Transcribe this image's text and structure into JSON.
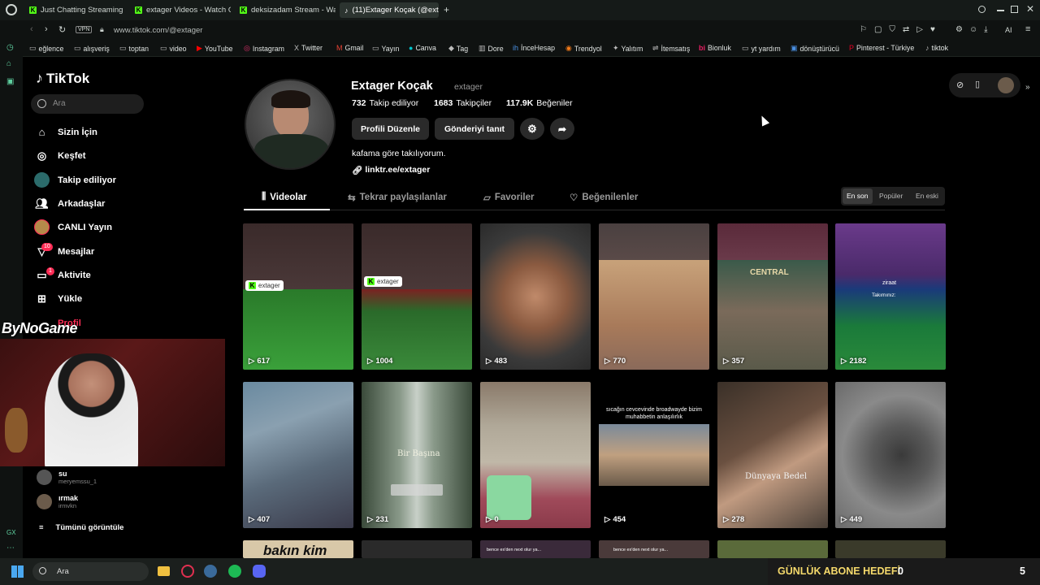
{
  "browser": {
    "tabs": [
      {
        "label": "Just Chatting Streaming - "
      },
      {
        "label": "extager Videos - Watch On"
      },
      {
        "label": "deksizadam Stream - Watc"
      },
      {
        "label": "(11)Extager Koçak (@extag"
      }
    ],
    "new_tab_glyph": "+",
    "vpn_label": "VPN",
    "url": "www.tiktok.com/@extager",
    "ai_label": "AI",
    "bookmarks": [
      {
        "label": "eğlence"
      },
      {
        "label": "alışveriş"
      },
      {
        "label": "toptan"
      },
      {
        "label": "video"
      },
      {
        "label": "YouTube"
      },
      {
        "label": "Instagram"
      },
      {
        "label": "Twitter"
      },
      {
        "label": "Gmail"
      },
      {
        "label": "Yayın"
      },
      {
        "label": "Canva"
      },
      {
        "label": "Tag"
      },
      {
        "label": "Dore"
      },
      {
        "label": "İnceHesap"
      },
      {
        "label": "Trendyol"
      },
      {
        "label": "Yalıtım"
      },
      {
        "label": "İtemsatış"
      },
      {
        "label": "Bionluk"
      },
      {
        "label": "yt yardım"
      },
      {
        "label": "dönüştürücü"
      },
      {
        "label": "Pinterest - Türkiye"
      },
      {
        "label": "tiktok"
      }
    ]
  },
  "sidebar": {
    "logo": "TikTok",
    "search_placeholder": "Ara",
    "items": [
      {
        "label": "Sizin İçin"
      },
      {
        "label": "Keşfet"
      },
      {
        "label": "Takip ediliyor"
      },
      {
        "label": "Arkadaşlar"
      },
      {
        "label": "CANLI Yayın"
      },
      {
        "label": "Mesajlar",
        "badge": "10"
      },
      {
        "label": "Aktivite",
        "badge": "1"
      },
      {
        "label": "Yükle"
      },
      {
        "label": "Profil"
      }
    ],
    "friends": [
      {
        "name": "su",
        "handle": "meryemssu_1"
      },
      {
        "name": "ırmak",
        "handle": "irmvkn"
      }
    ],
    "see_all": "Tümünü görüntüle"
  },
  "overlay": {
    "brand": "ByNoGame"
  },
  "profile": {
    "name": "Extager Koçak",
    "handle": "extager",
    "following_count": "732",
    "following_label": "Takip ediliyor",
    "followers_count": "1683",
    "followers_label": "Takipçiler",
    "likes_count": "117.9K",
    "likes_label": "Beğeniler",
    "edit_button": "Profili Düzenle",
    "promote_button": "Gönderiyi tanıt",
    "bio": "kafama göre takılıyorum.",
    "link": "linktr.ee/extager",
    "tabs": [
      {
        "label": "Videolar"
      },
      {
        "label": "Tekrar paylaşılanlar"
      },
      {
        "label": "Favoriler"
      },
      {
        "label": "Beğenilenler"
      }
    ],
    "sort": [
      "En son",
      "Popüler",
      "En eski"
    ]
  },
  "videos": [
    {
      "views": "617",
      "tag": "extager"
    },
    {
      "views": "1004",
      "tag": "extager"
    },
    {
      "views": "483"
    },
    {
      "views": "770"
    },
    {
      "views": "357",
      "overlay": "CENTRAL"
    },
    {
      "views": "2182",
      "overlay": "Takımınız:",
      "overlay2": "ziraat"
    },
    {
      "views": "407"
    },
    {
      "views": "231",
      "overlay": "Bir Başına"
    },
    {
      "views": "0"
    },
    {
      "views": "454",
      "overlay": "sıcağın cevcevinde broadwayde bizim muhabbetin anlaşılırlık"
    },
    {
      "views": "278",
      "overlay": "Dünyaya Bedel"
    },
    {
      "views": "449"
    }
  ],
  "row3": [
    {
      "overlay": "bakın kim"
    },
    {
      "overlay": ""
    },
    {
      "overlay": "bence ex'den next olur ya..."
    },
    {
      "overlay": "bence ex'den next olur ya..."
    },
    {
      "overlay": ""
    },
    {
      "overlay": ""
    }
  ],
  "taskbar": {
    "search_placeholder": "Ara"
  },
  "stream_goal": {
    "label": "GÜNLÜK ABONE HEDEFİ",
    "current": "0",
    "target": "5"
  }
}
